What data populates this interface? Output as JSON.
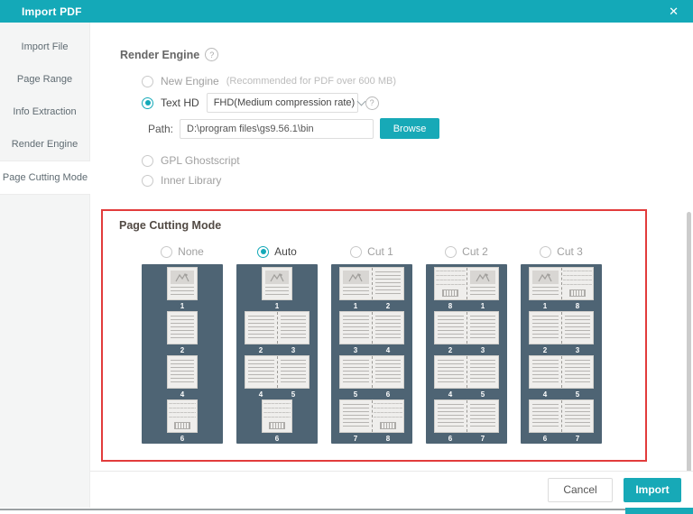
{
  "titlebar": {
    "title": "Import PDF",
    "close_icon": "✕"
  },
  "sidebar": {
    "items": [
      {
        "label": "Import File",
        "selected": false
      },
      {
        "label": "Page Range",
        "selected": false
      },
      {
        "label": "Info Extraction",
        "selected": false
      },
      {
        "label": "Render Engine",
        "selected": false
      },
      {
        "label": "Page Cutting Mode",
        "selected": true
      }
    ]
  },
  "render_engine": {
    "heading": "Render Engine",
    "help_icon": "?",
    "options": [
      {
        "label": "New Engine",
        "hint": "(Recommended for PDF over 600 MB)",
        "selected": false
      },
      {
        "label": "Text HD",
        "selected": true,
        "dropdown_value": "FHD(Medium compression rate)"
      },
      {
        "label": "GPL Ghostscript",
        "selected": false
      },
      {
        "label": "Inner Library",
        "selected": false
      }
    ],
    "path_label": "Path:",
    "path_value": "D:\\program files\\gs9.56.1\\bin",
    "browse_label": "Browse"
  },
  "page_cutting": {
    "heading": "Page Cutting Mode",
    "modes": [
      {
        "label": "None",
        "selected": false,
        "rows": [
          {
            "pages": [
              {
                "type": "image",
                "num": "1"
              }
            ]
          },
          {
            "pages": [
              {
                "type": "text",
                "num": "2"
              }
            ]
          },
          {
            "pages": [
              {
                "type": "text",
                "num": "4"
              }
            ]
          },
          {
            "pages": [
              {
                "type": "wavy",
                "num": "6"
              }
            ]
          }
        ]
      },
      {
        "label": "Auto",
        "selected": true,
        "rows": [
          {
            "pages": [
              {
                "type": "image",
                "num": "1"
              }
            ]
          },
          {
            "pages": [
              {
                "type": "text",
                "num": "2"
              },
              {
                "type": "text",
                "num": "3"
              }
            ]
          },
          {
            "pages": [
              {
                "type": "text",
                "num": "4"
              },
              {
                "type": "text",
                "num": "5"
              }
            ]
          },
          {
            "pages": [
              {
                "type": "wavy",
                "num": "6"
              }
            ]
          }
        ]
      },
      {
        "label": "Cut 1",
        "selected": false,
        "rows": [
          {
            "pages": [
              {
                "type": "image",
                "num": "1"
              },
              {
                "type": "text",
                "num": "2"
              }
            ]
          },
          {
            "pages": [
              {
                "type": "text",
                "num": "3"
              },
              {
                "type": "text",
                "num": "4"
              }
            ]
          },
          {
            "pages": [
              {
                "type": "text",
                "num": "5"
              },
              {
                "type": "text",
                "num": "6"
              }
            ]
          },
          {
            "pages": [
              {
                "type": "text",
                "num": "7"
              },
              {
                "type": "wavy",
                "num": "8"
              }
            ]
          }
        ]
      },
      {
        "label": "Cut 2",
        "selected": false,
        "rows": [
          {
            "pages": [
              {
                "type": "wavy",
                "num": "8"
              },
              {
                "type": "image",
                "num": "1"
              }
            ]
          },
          {
            "pages": [
              {
                "type": "text",
                "num": "2"
              },
              {
                "type": "text",
                "num": "3"
              }
            ]
          },
          {
            "pages": [
              {
                "type": "text",
                "num": "4"
              },
              {
                "type": "text",
                "num": "5"
              }
            ]
          },
          {
            "pages": [
              {
                "type": "text",
                "num": "6"
              },
              {
                "type": "text",
                "num": "7"
              }
            ]
          }
        ]
      },
      {
        "label": "Cut 3",
        "selected": false,
        "rows": [
          {
            "pages": [
              {
                "type": "image",
                "num": "1"
              },
              {
                "type": "wavy",
                "num": "8"
              }
            ]
          },
          {
            "pages": [
              {
                "type": "text",
                "num": "2"
              },
              {
                "type": "text",
                "num": "3"
              }
            ]
          },
          {
            "pages": [
              {
                "type": "text",
                "num": "4"
              },
              {
                "type": "text",
                "num": "5"
              }
            ]
          },
          {
            "pages": [
              {
                "type": "text",
                "num": "6"
              },
              {
                "type": "text",
                "num": "7"
              }
            ]
          }
        ]
      }
    ]
  },
  "footer": {
    "cancel_label": "Cancel",
    "import_label": "Import"
  },
  "colors": {
    "accent": "#17a9b7",
    "preview_bg": "#4e6474",
    "highlight_border": "#e23c3c"
  }
}
